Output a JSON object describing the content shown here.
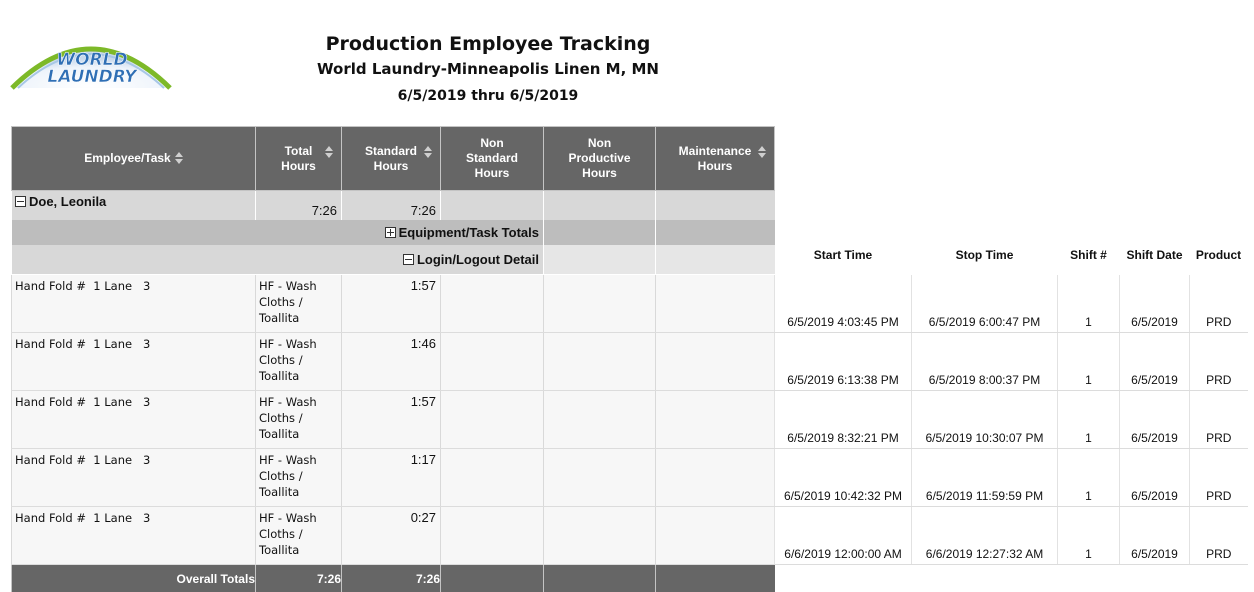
{
  "logo": {
    "line1": "WORLD",
    "line2": "LAUNDRY"
  },
  "report": {
    "title": "Production Employee Tracking",
    "subtitle": "World Laundry-Minneapolis Linen M, MN",
    "date_range": "6/5/2019 thru 6/5/2019"
  },
  "columns": {
    "employee_task": "Employee/Task",
    "total_hours": [
      "Total",
      "Hours"
    ],
    "standard_hours": [
      "Standard",
      "Hours"
    ],
    "non_standard_hours": [
      "Non",
      "Standard",
      "Hours"
    ],
    "non_productive_hours": [
      "Non",
      "Productive",
      "Hours"
    ],
    "maintenance_hours": [
      "Maintenance",
      "Hours"
    ]
  },
  "employee": {
    "name": "Doe, Leonila",
    "total": "7:26",
    "standard": "7:26"
  },
  "groups": {
    "equipment_totals": "Equipment/Task Totals",
    "login_detail": "Login/Logout Detail"
  },
  "detail_columns": {
    "start": "Start Time",
    "stop": "Stop Time",
    "shift": "Shift #",
    "shift_date": "Shift Date",
    "product": "Product"
  },
  "rows": [
    {
      "employee": "Hand Fold #  1 Lane   3",
      "task": [
        "HF - Wash",
        "Cloths /",
        "Toallita"
      ],
      "total": "1:57",
      "start": "6/5/2019 4:03:45 PM",
      "stop": "6/5/2019 6:00:47 PM",
      "shift": "1",
      "date": "6/5/2019",
      "product": "PRD"
    },
    {
      "employee": "Hand Fold #  1 Lane   3",
      "task": [
        "HF - Wash",
        "Cloths /",
        "Toallita"
      ],
      "total": "1:46",
      "start": "6/5/2019 6:13:38 PM",
      "stop": "6/5/2019 8:00:37 PM",
      "shift": "1",
      "date": "6/5/2019",
      "product": "PRD"
    },
    {
      "employee": "Hand Fold #  1 Lane   3",
      "task": [
        "HF - Wash",
        "Cloths /",
        "Toallita"
      ],
      "total": "1:57",
      "start": "6/5/2019 8:32:21 PM",
      "stop": "6/5/2019 10:30:07 PM",
      "shift": "1",
      "date": "6/5/2019",
      "product": "PRD"
    },
    {
      "employee": "Hand Fold #  1 Lane   3",
      "task": [
        "HF - Wash",
        "Cloths /",
        "Toallita"
      ],
      "total": "1:17",
      "start": "6/5/2019 10:42:32 PM",
      "stop": "6/5/2019 11:59:59 PM",
      "shift": "1",
      "date": "6/5/2019",
      "product": "PRD"
    },
    {
      "employee": "Hand Fold #  1 Lane   3",
      "task": [
        "HF - Wash",
        "Cloths /",
        "Toallita"
      ],
      "total": "0:27",
      "start": "6/6/2019 12:00:00 AM",
      "stop": "6/6/2019 12:27:32 AM",
      "shift": "1",
      "date": "6/5/2019",
      "product": "PRD"
    }
  ],
  "footer": {
    "label": "Overall Totals",
    "total": "7:26",
    "standard": "7:26"
  },
  "colors": {
    "header_bg": "#666666",
    "group_bg": "#d8d8d8",
    "highlight": "#d90f0f",
    "logo_green": "#7db928",
    "logo_blue": "#2f6fb5"
  }
}
